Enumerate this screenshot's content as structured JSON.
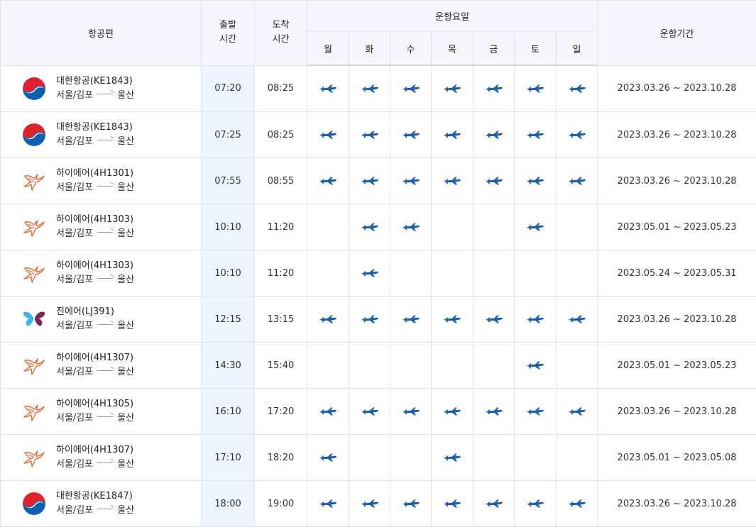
{
  "header": {
    "flight": "항공편",
    "departure_line1": "출발",
    "departure_line2": "시간",
    "arrival_line1": "도착",
    "arrival_line2": "시간",
    "days_of_operation": "운항요일",
    "period": "운항기간",
    "days": [
      "월",
      "화",
      "수",
      "목",
      "금",
      "토",
      "일"
    ]
  },
  "colors": {
    "plane": "#1f5fa8",
    "header_bg": "#f4f7fb",
    "departure_bg": "#eef5ff",
    "border": "#dfe3ea"
  },
  "flights": [
    {
      "airline_logo": "korean-air-logo",
      "name": "대한항공(KE1843)",
      "from": "서울/김포",
      "to": "울산",
      "dep": "07:20",
      "arr": "08:25",
      "days": [
        true,
        true,
        true,
        true,
        true,
        true,
        true
      ],
      "period": "2023.03.26 ~ 2023.10.28"
    },
    {
      "airline_logo": "korean-air-logo",
      "name": "대한항공(KE1843)",
      "from": "서울/김포",
      "to": "울산",
      "dep": "07:25",
      "arr": "08:25",
      "days": [
        true,
        true,
        true,
        true,
        true,
        true,
        true
      ],
      "period": "2023.03.26 ~ 2023.10.28"
    },
    {
      "airline_logo": "hi-air-logo",
      "name": "하이에어(4H1301)",
      "from": "서울/김포",
      "to": "울산",
      "dep": "07:55",
      "arr": "08:55",
      "days": [
        true,
        true,
        true,
        true,
        true,
        true,
        true
      ],
      "period": "2023.03.26 ~ 2023.10.28"
    },
    {
      "airline_logo": "hi-air-logo",
      "name": "하이에어(4H1303)",
      "from": "서울/김포",
      "to": "울산",
      "dep": "10:10",
      "arr": "11:20",
      "days": [
        false,
        true,
        true,
        false,
        false,
        true,
        false
      ],
      "period": "2023.05.01 ~ 2023.05.23"
    },
    {
      "airline_logo": "hi-air-logo",
      "name": "하이에어(4H1303)",
      "from": "서울/김포",
      "to": "울산",
      "dep": "10:10",
      "arr": "11:20",
      "days": [
        false,
        true,
        false,
        false,
        false,
        false,
        false
      ],
      "period": "2023.05.24 ~ 2023.05.31"
    },
    {
      "airline_logo": "jin-air-logo",
      "name": "진에어(LJ391)",
      "from": "서울/김포",
      "to": "울산",
      "dep": "12:15",
      "arr": "13:15",
      "days": [
        true,
        true,
        true,
        true,
        true,
        true,
        true
      ],
      "period": "2023.03.26 ~ 2023.10.28"
    },
    {
      "airline_logo": "hi-air-logo",
      "name": "하이에어(4H1307)",
      "from": "서울/김포",
      "to": "울산",
      "dep": "14:30",
      "arr": "15:40",
      "days": [
        false,
        false,
        false,
        false,
        false,
        true,
        false
      ],
      "period": "2023.05.01 ~ 2023.05.23"
    },
    {
      "airline_logo": "hi-air-logo",
      "name": "하이에어(4H1305)",
      "from": "서울/김포",
      "to": "울산",
      "dep": "16:10",
      "arr": "17:20",
      "days": [
        true,
        true,
        true,
        true,
        true,
        true,
        true
      ],
      "period": "2023.03.26 ~ 2023.10.28"
    },
    {
      "airline_logo": "hi-air-logo",
      "name": "하이에어(4H1307)",
      "from": "서울/김포",
      "to": "울산",
      "dep": "17:10",
      "arr": "18:20",
      "days": [
        true,
        false,
        false,
        true,
        false,
        false,
        false
      ],
      "period": "2023.05.01 ~ 2023.05.08"
    },
    {
      "airline_logo": "korean-air-logo",
      "name": "대한항공(KE1847)",
      "from": "서울/김포",
      "to": "울산",
      "dep": "18:00",
      "arr": "19:00",
      "days": [
        true,
        true,
        true,
        true,
        true,
        true,
        true
      ],
      "period": "2023.03.26 ~ 2023.10.28"
    }
  ]
}
